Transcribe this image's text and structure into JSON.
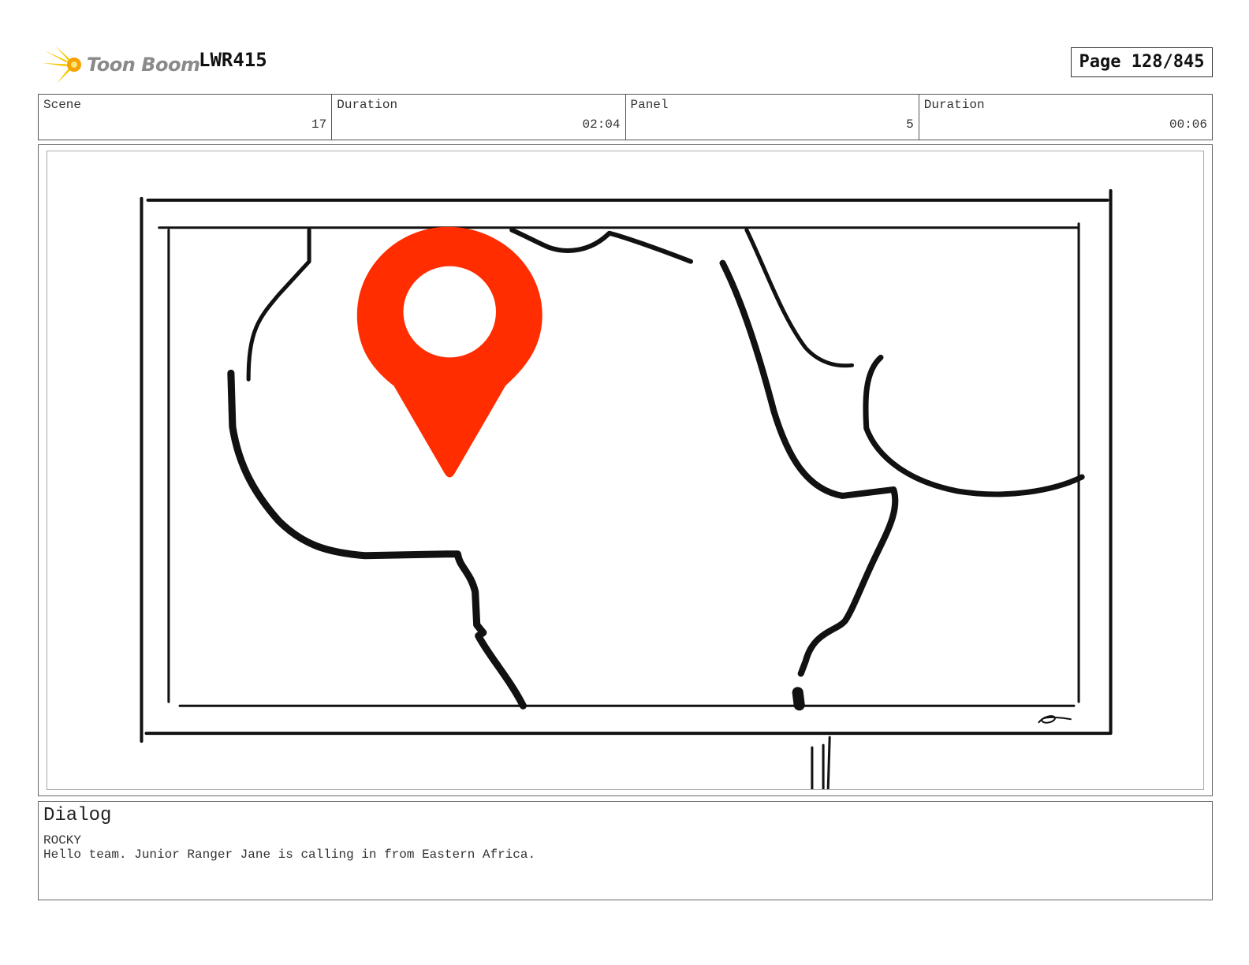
{
  "header": {
    "logo_text": "Toon Boom",
    "logo_icon": "toon-boom-burst-icon",
    "project_code": "LWR415",
    "page_label": "Page 128/845"
  },
  "info": {
    "scene_label": "Scene",
    "scene_value": "17",
    "scene_duration_label": "Duration",
    "scene_duration_value": "02:04",
    "panel_label": "Panel",
    "panel_value": "5",
    "panel_duration_label": "Duration",
    "panel_duration_value": "00:06"
  },
  "panel": {
    "drawing": "map-of-africa-on-screen-with-location-pin",
    "pin_color": "#ff2d00",
    "line_color": "#111111"
  },
  "dialog": {
    "title": "Dialog",
    "speaker": "ROCKY",
    "line": "Hello team. Junior Ranger Jane is calling in from Eastern Africa."
  }
}
